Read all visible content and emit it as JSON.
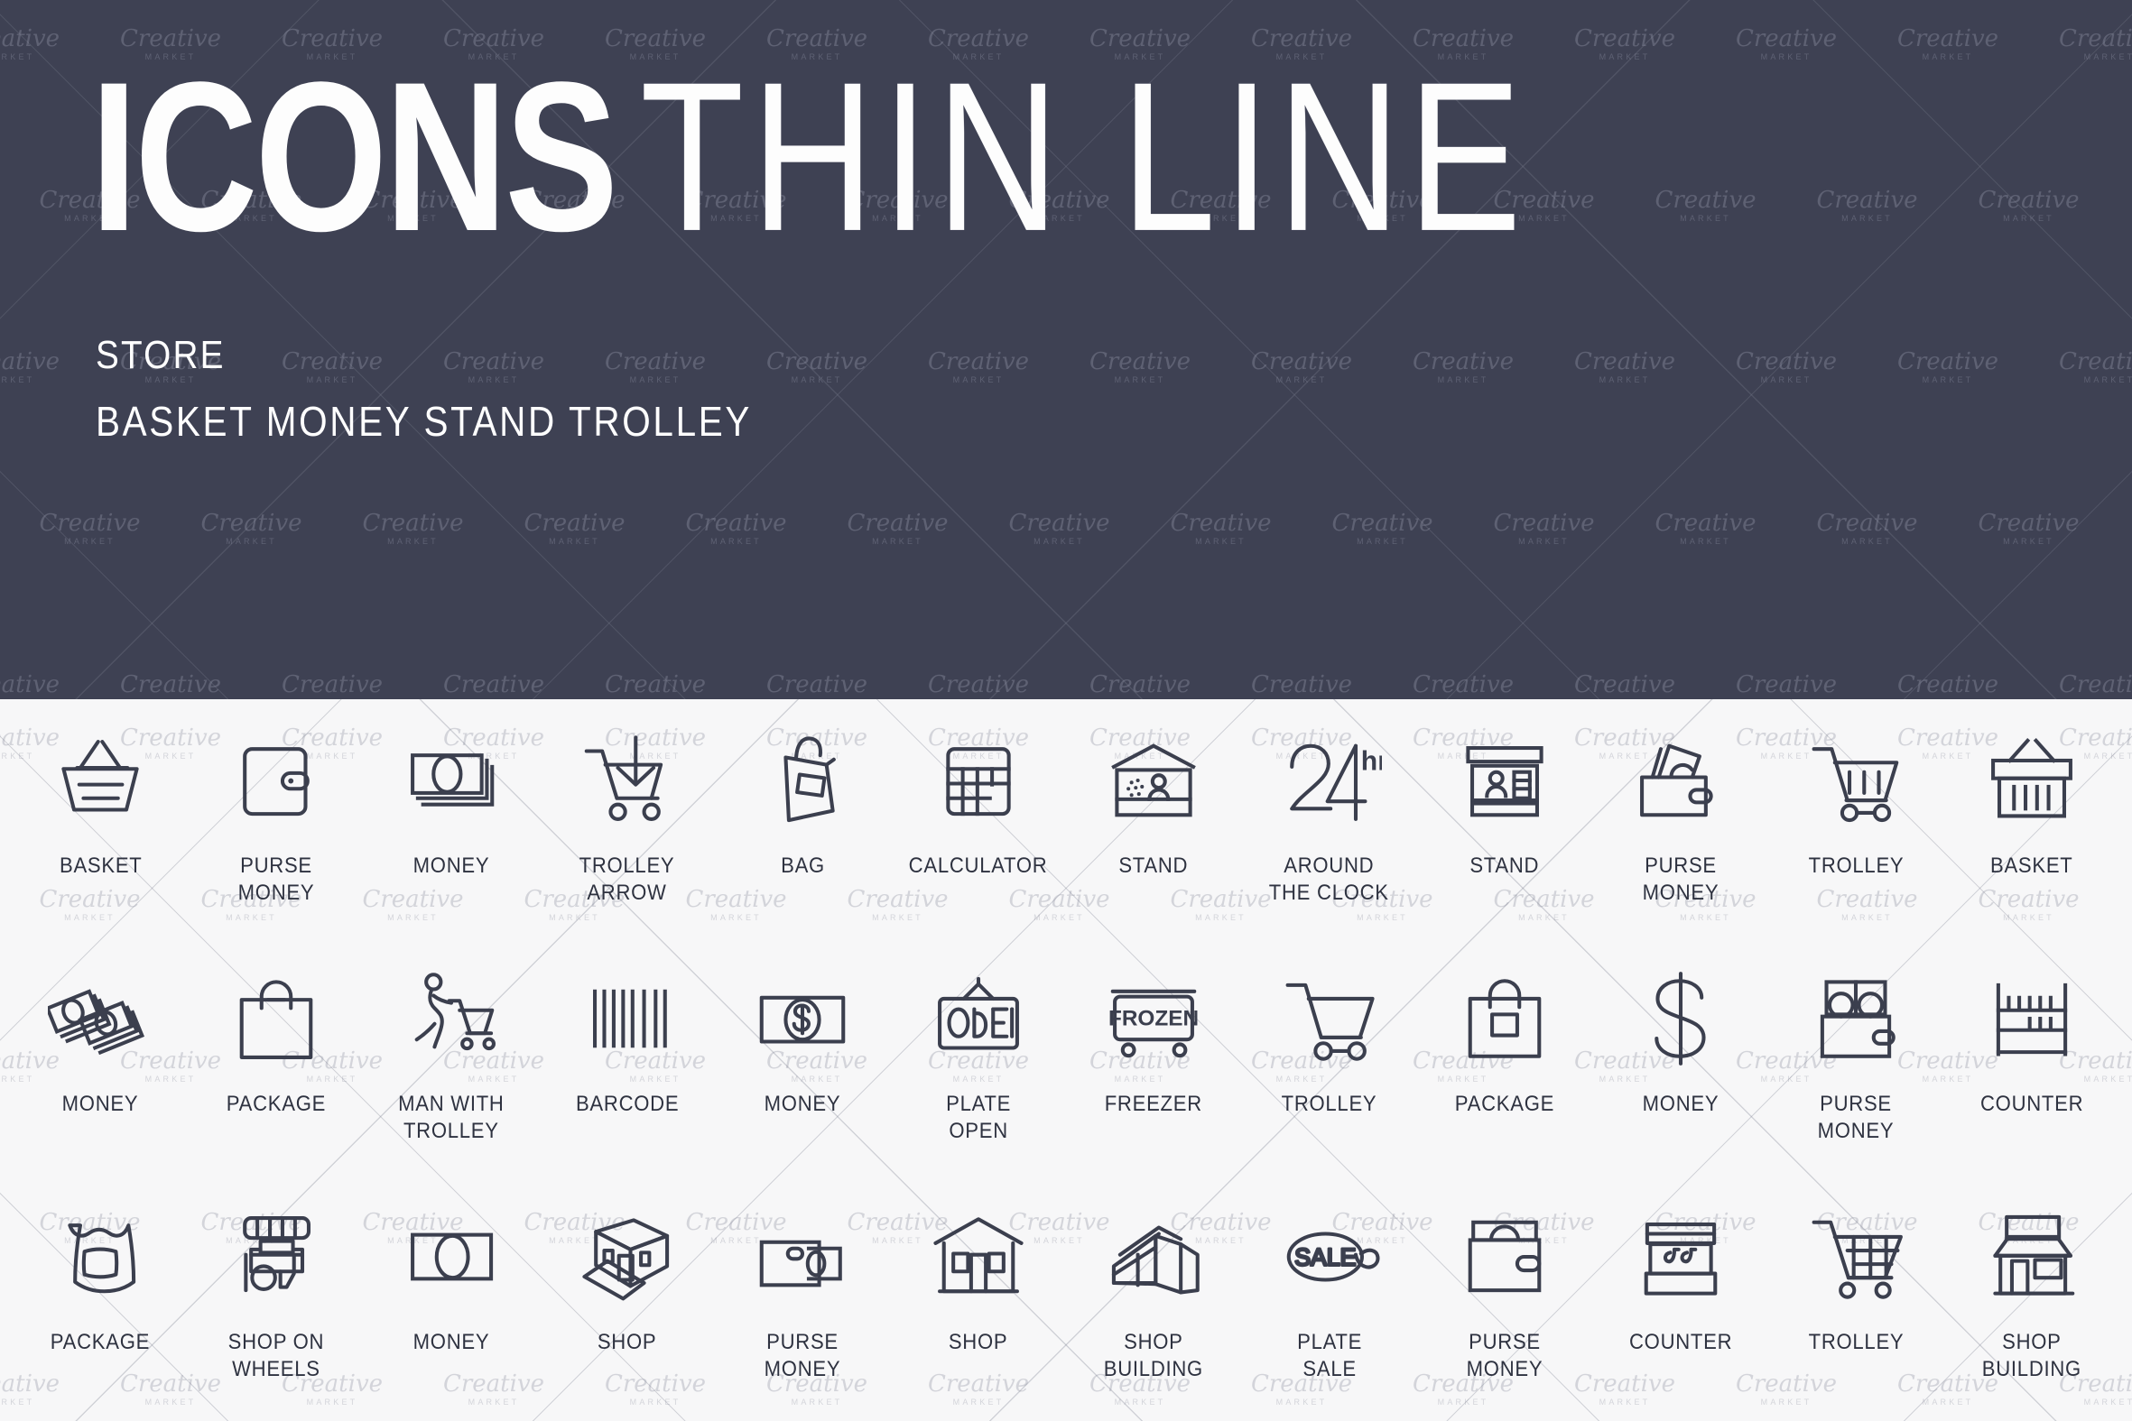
{
  "header": {
    "title_bold": "ICONS",
    "title_thin": "THIN LINE",
    "subtitle_line1": "STORE",
    "subtitle_line2": "BASKET MONEY STAND TROLLEY",
    "background_color": "#3e4153",
    "text_color": "#fdfdfd"
  },
  "watermark": {
    "brand": "Creative",
    "sub": "MARKET"
  },
  "grid": {
    "columns": 12,
    "rows": 3,
    "stroke_color": "#3b3f4e",
    "background_color": "#f7f7f8",
    "label_color": "#2e3240",
    "items": [
      {
        "label": "BASKET",
        "icon": "basket-handles-icon"
      },
      {
        "label": "PURSE\nMONEY",
        "icon": "wallet-icon"
      },
      {
        "label": "MONEY",
        "icon": "banknote-stack-icon"
      },
      {
        "label": "TROLLEY\nARROW",
        "icon": "trolley-arrow-down-icon"
      },
      {
        "label": "BAG",
        "icon": "paper-bag-icon"
      },
      {
        "label": "CALCULATOR",
        "icon": "calculator-icon"
      },
      {
        "label": "STAND",
        "icon": "market-stand-icon"
      },
      {
        "label": "AROUND\nTHE CLOCK",
        "icon": "24hrs-icon"
      },
      {
        "label": "STAND",
        "icon": "kiosk-stand-icon"
      },
      {
        "label": "PURSE\nMONEY",
        "icon": "wallet-with-bills-icon"
      },
      {
        "label": "TROLLEY",
        "icon": "shopping-cart-filled-icon"
      },
      {
        "label": "BASKET",
        "icon": "basket-bars-icon"
      },
      {
        "label": "MONEY",
        "icon": "money-bundles-tilted-icon"
      },
      {
        "label": "PACKAGE",
        "icon": "shopping-bag-handle-icon"
      },
      {
        "label": "MAN WITH\nTROLLEY",
        "icon": "man-pushing-trolley-icon"
      },
      {
        "label": "BARCODE",
        "icon": "barcode-icon"
      },
      {
        "label": "MONEY",
        "icon": "dollar-banknote-icon"
      },
      {
        "label": "PLATE\nOPEN",
        "icon": "open-sign-icon"
      },
      {
        "label": "FREEZER",
        "icon": "frozen-freezer-icon"
      },
      {
        "label": "TROLLEY",
        "icon": "shopping-cart-empty-icon"
      },
      {
        "label": "PACKAGE",
        "icon": "bag-with-label-icon"
      },
      {
        "label": "MONEY",
        "icon": "dollar-sign-icon"
      },
      {
        "label": "PURSE\nMONEY",
        "icon": "wallet-coins-icon"
      },
      {
        "label": "COUNTER",
        "icon": "shelf-counter-icon"
      },
      {
        "label": "PACKAGE",
        "icon": "plastic-bag-icon"
      },
      {
        "label": "SHOP ON\nWHEELS",
        "icon": "food-cart-icon"
      },
      {
        "label": "MONEY",
        "icon": "single-banknote-icon"
      },
      {
        "label": "SHOP",
        "icon": "shop-isometric-icon"
      },
      {
        "label": "PURSE\nMONEY",
        "icon": "wallet-bill-out-icon"
      },
      {
        "label": "SHOP",
        "icon": "house-shop-icon"
      },
      {
        "label": "SHOP\nBUILDING",
        "icon": "modern-building-icon"
      },
      {
        "label": "PLATE\nSALE",
        "icon": "sale-tag-icon"
      },
      {
        "label": "PURSE\nMONEY",
        "icon": "wallet-bag-icon"
      },
      {
        "label": "COUNTER",
        "icon": "market-counter-icon"
      },
      {
        "label": "TROLLEY",
        "icon": "trolley-grid-icon"
      },
      {
        "label": "SHOP\nBUILDING",
        "icon": "storefront-awning-icon"
      }
    ]
  }
}
